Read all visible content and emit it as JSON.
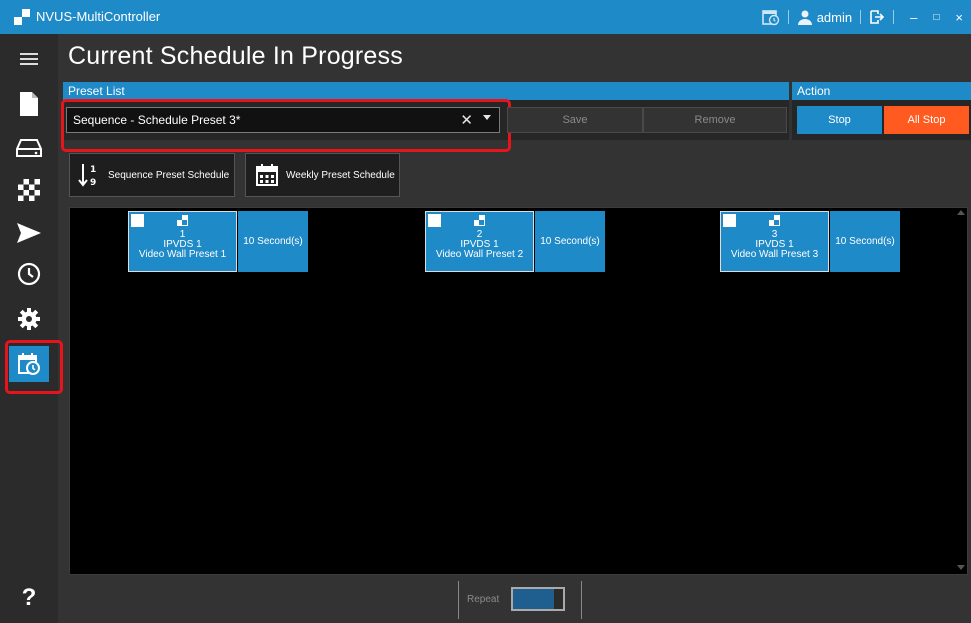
{
  "window": {
    "title": "NVUS-MultiController",
    "user": "admin"
  },
  "page": {
    "title": "Current Schedule In Progress"
  },
  "preset_panel": {
    "header": "Preset List",
    "selected_preset": "Sequence - Schedule Preset 3*",
    "clear_symbol": "✕",
    "save_label": "Save",
    "remove_label": "Remove"
  },
  "action_panel": {
    "header": "Action",
    "stop_label": "Stop",
    "all_stop_label": "All Stop"
  },
  "modes": {
    "sequence_label": "Sequence Preset Schedule",
    "weekly_label": "Weekly Preset Schedule"
  },
  "sequence": [
    {
      "index": "1",
      "device": "IPVDS 1",
      "preset": "Video Wall Preset 1",
      "duration": "10 Second(s)"
    },
    {
      "index": "2",
      "device": "IPVDS 1",
      "preset": "Video Wall Preset 2",
      "duration": "10 Second(s)"
    },
    {
      "index": "3",
      "device": "IPVDS 1",
      "preset": "Video Wall Preset 3",
      "duration": "10 Second(s)"
    }
  ],
  "footer": {
    "repeat_label": "Repeat",
    "repeat_on": true
  },
  "sidebar": {
    "help_label": "?"
  },
  "colors": {
    "accent": "#1f8ac8",
    "danger": "#ff5a1f",
    "highlight": "#e8141b",
    "background": "#333333"
  },
  "icons": [
    "menu-icon",
    "document-icon",
    "drive-icon",
    "checker-icon",
    "send-icon",
    "clock-icon",
    "gear-icon",
    "calendar-clock-icon",
    "help-icon",
    "logout-icon",
    "minimize-icon",
    "maximize-icon",
    "close-icon",
    "sort-numeric-icon",
    "calendar-icon"
  ]
}
